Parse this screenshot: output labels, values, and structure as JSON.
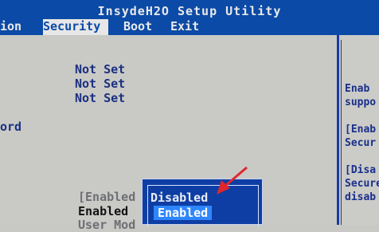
{
  "window": {
    "title": "InsydeH2O Setup Utility"
  },
  "menu": {
    "tabs": [
      {
        "label": "ion"
      },
      {
        "label": "Security",
        "active": true
      },
      {
        "label": "Boot"
      },
      {
        "label": "Exit"
      }
    ]
  },
  "settings": {
    "values": [
      "Not Set",
      "Not Set",
      "Not Set"
    ],
    "password_label": "ord",
    "row_selected": "[Enabled",
    "row_enabled": "Enabled",
    "row_partial": "User Mod"
  },
  "help": {
    "lines": [
      "Enab",
      "suppo",
      "[Enab",
      "Secur",
      "[Disa",
      "Secure",
      "disab"
    ]
  },
  "popup": {
    "options": [
      "Disabled",
      "Enabled"
    ],
    "selected": "Enabled"
  },
  "colors": {
    "header_blue": "#0b4aa6",
    "popup_blue": "#0e3ea4",
    "highlight_blue": "#2e86ff",
    "annotation_red": "#e0262f"
  }
}
